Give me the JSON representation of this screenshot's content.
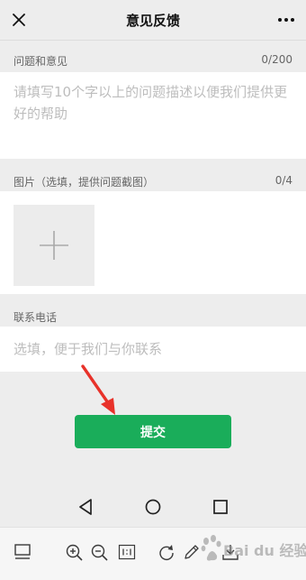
{
  "header": {
    "title": "意见反馈"
  },
  "feedback": {
    "label": "问题和意见",
    "count": "0/200",
    "placeholder": "请填写10个字以上的问题描述以便我们提供更好的帮助"
  },
  "images": {
    "label": "图片（选填，提供问题截图）",
    "count": "0/4"
  },
  "contact": {
    "label": "联系电话",
    "placeholder": "选填，便于我们与你联系"
  },
  "submit": {
    "label": "提交"
  },
  "watermark": {
    "text": "Bai du 经验"
  },
  "colors": {
    "primary": "#1aad5a",
    "annotation": "#e8322a",
    "background": "#ededed"
  }
}
